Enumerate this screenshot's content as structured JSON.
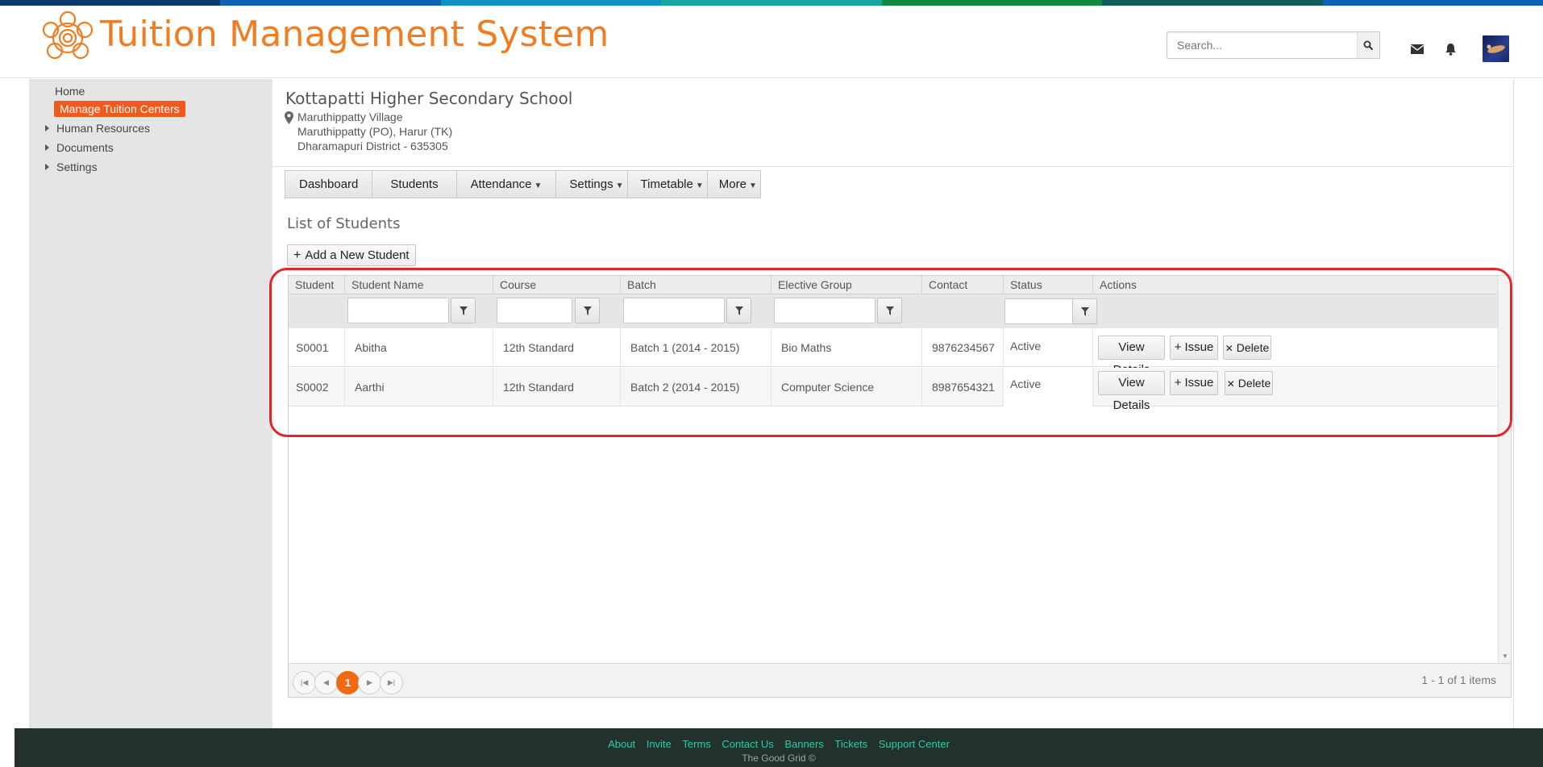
{
  "brand": {
    "title": "Tuition Management System",
    "accent": "#f07d22",
    "topbar_colors": [
      "#0a3a6b",
      "#0d63b8",
      "#0b93c4",
      "#12a8a0",
      "#0f8a3c",
      "#0b5c5a"
    ]
  },
  "header": {
    "search_placeholder": "Search...",
    "icons": [
      "mail-icon",
      "bell-icon",
      "avatar"
    ]
  },
  "sidebar": {
    "home": "Home",
    "active": "Manage Tuition  Centers",
    "items": [
      {
        "label": "Human Resources"
      },
      {
        "label": "Documents"
      },
      {
        "label": "Settings"
      }
    ]
  },
  "school": {
    "name": "Kottapatti Higher Secondary School",
    "address": [
      "Maruthippatty Village",
      "Maruthippatty (PO), Harur (TK)",
      "Dharamapuri District - 635305"
    ]
  },
  "tabs": [
    {
      "label": "Dashboard",
      "has_caret": false
    },
    {
      "label": "Students",
      "has_caret": false
    },
    {
      "label": "Attendance",
      "has_caret": true
    },
    {
      "label": "Settings",
      "has_caret": true
    },
    {
      "label": "Timetable",
      "has_caret": true
    },
    {
      "label": "More",
      "has_caret": true
    }
  ],
  "list": {
    "title": "List of Students",
    "add_button": "Add a New Student"
  },
  "grid": {
    "columns": [
      "Student ID",
      "Student Name",
      "Course",
      "Batch",
      "Elective Group",
      "Contact Number",
      "Status",
      "Actions"
    ],
    "rows": [
      {
        "id": "S0001",
        "name": "Abitha",
        "course": "12th Standard",
        "batch": "Batch 1 (2014 - 2015)",
        "elective": "Bio Maths",
        "contact": "9876234567",
        "status": "Active"
      },
      {
        "id": "S0002",
        "name": "Aarthi",
        "course": "12th Standard",
        "batch": "Batch 2 (2014 - 2015)",
        "elective": "Computer Science",
        "contact": "8987654321",
        "status": "Active"
      }
    ],
    "actions": {
      "view": "View Details",
      "issue": "Issue",
      "delete": "Delete"
    },
    "pager": {
      "current_page": "1",
      "info": "1 - 1 of 1 items"
    }
  },
  "footer": {
    "links": [
      "About",
      "Invite",
      "Terms",
      "Contact Us",
      "Banners",
      "Tickets",
      "Support Center"
    ],
    "copyright": "The Good Grid ©"
  }
}
